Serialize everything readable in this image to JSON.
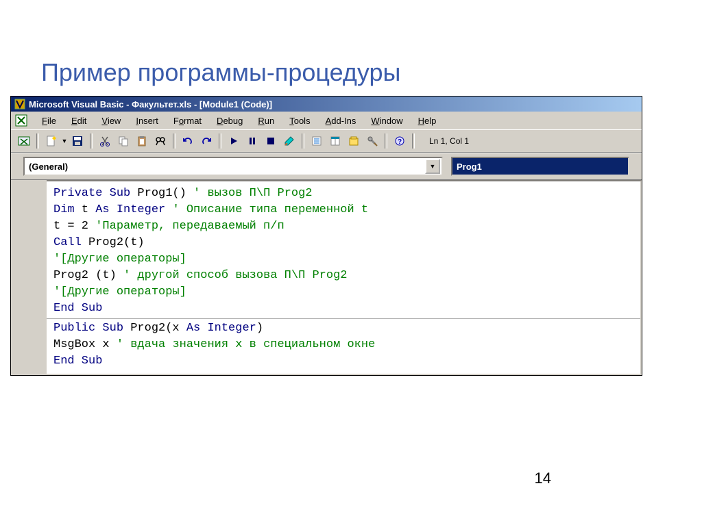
{
  "slide": {
    "title": "Пример программы-процедуры",
    "page_number": "14"
  },
  "titlebar": {
    "text": "Microsoft Visual Basic - Факультет.xls - [Module1 (Code)]"
  },
  "menu": {
    "items": [
      "File",
      "Edit",
      "View",
      "Insert",
      "Format",
      "Debug",
      "Run",
      "Tools",
      "Add-Ins",
      "Window",
      "Help"
    ]
  },
  "toolbar": {
    "status": "Ln 1, Col 1"
  },
  "object_combo": {
    "value": "(General)"
  },
  "proc_combo": {
    "value": "Prog1"
  },
  "code": {
    "lines": [
      [
        {
          "t": "Private Sub ",
          "c": "kw"
        },
        {
          "t": "Prog1() ",
          "c": ""
        },
        {
          "t": "' вызов П\\П Prog2",
          "c": "cm"
        }
      ],
      [
        {
          "t": "Dim ",
          "c": "kw"
        },
        {
          "t": "t ",
          "c": ""
        },
        {
          "t": "As Integer ",
          "c": "kw"
        },
        {
          "t": "' Описание типа переменной t",
          "c": "cm"
        }
      ],
      [
        {
          "t": "t = 2 ",
          "c": ""
        },
        {
          "t": "'Параметр, передаваемый п/п",
          "c": "cm"
        }
      ],
      [
        {
          "t": "Call ",
          "c": "kw"
        },
        {
          "t": "Prog2(t)",
          "c": ""
        }
      ],
      [
        {
          "t": "'[Другие операторы]",
          "c": "cm"
        }
      ],
      [
        {
          "t": "Prog2 (t) ",
          "c": ""
        },
        {
          "t": "' другой способ вызова П\\П Prog2",
          "c": "cm"
        }
      ],
      [
        {
          "t": "'[Другие операторы]",
          "c": "cm"
        }
      ],
      [
        {
          "t": "End Sub",
          "c": "kw"
        }
      ],
      "---",
      [
        {
          "t": "Public Sub ",
          "c": "kw"
        },
        {
          "t": "Prog2(x ",
          "c": ""
        },
        {
          "t": "As Integer",
          "c": "kw"
        },
        {
          "t": ")",
          "c": ""
        }
      ],
      [
        {
          "t": "MsgBox x ",
          "c": ""
        },
        {
          "t": "' вдача значения x в специальном окне",
          "c": "cm"
        }
      ],
      [
        {
          "t": "End Sub",
          "c": "kw"
        }
      ]
    ]
  }
}
